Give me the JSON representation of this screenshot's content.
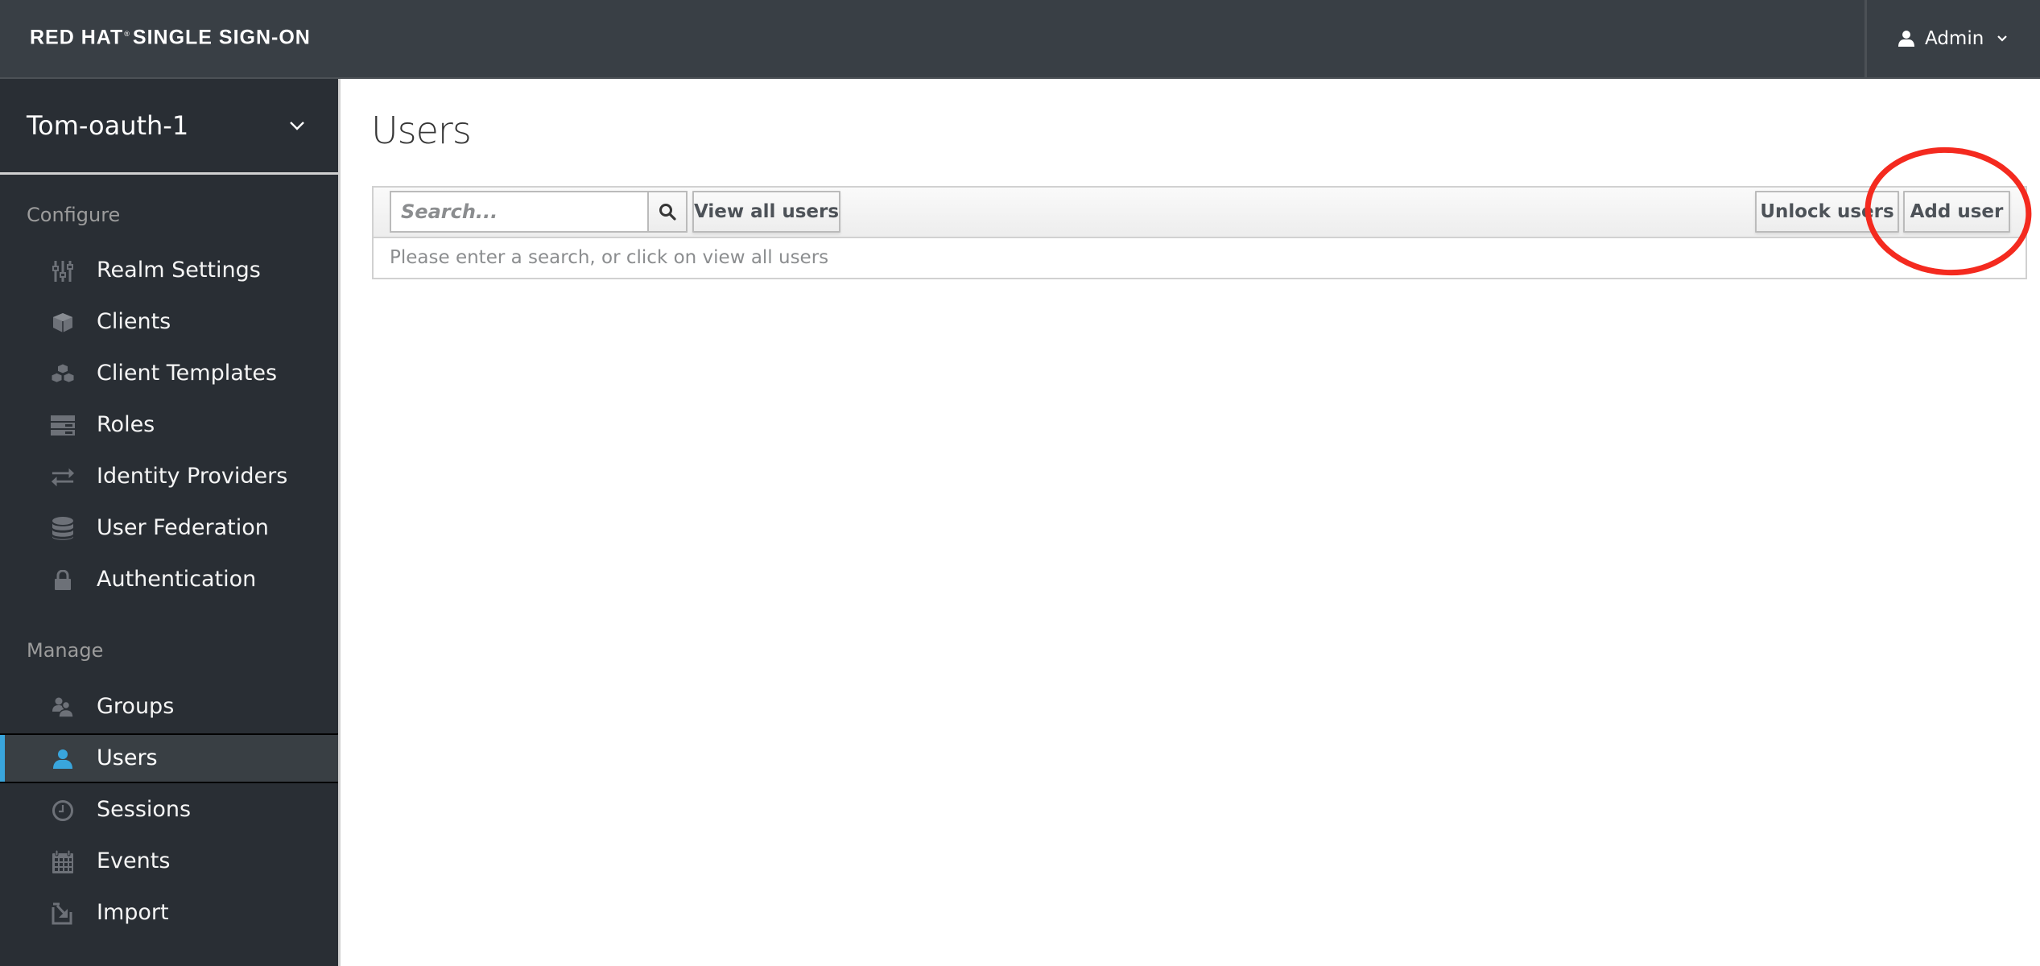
{
  "header": {
    "brand_bold": "RED HAT",
    "brand_reg": "®",
    "brand_rest": "SINGLE SIGN-ON",
    "user_icon": "user-icon",
    "user_name": "Admin",
    "user_caret_icon": "chevron-down-icon"
  },
  "sidebar": {
    "realm": {
      "name": "Tom-oauth-1",
      "caret_icon": "chevron-down-icon"
    },
    "sections": [
      {
        "title": "Configure",
        "items": [
          {
            "label": "Realm Settings",
            "icon": "sliders-icon",
            "active": false
          },
          {
            "label": "Clients",
            "icon": "cube-icon",
            "active": false
          },
          {
            "label": "Client Templates",
            "icon": "cubes-icon",
            "active": false
          },
          {
            "label": "Roles",
            "icon": "server-icon",
            "active": false
          },
          {
            "label": "Identity Providers",
            "icon": "exchange-icon",
            "active": false
          },
          {
            "label": "User Federation",
            "icon": "database-icon",
            "active": false
          },
          {
            "label": "Authentication",
            "icon": "lock-icon",
            "active": false
          }
        ]
      },
      {
        "title": "Manage",
        "items": [
          {
            "label": "Groups",
            "icon": "users-icon",
            "active": false
          },
          {
            "label": "Users",
            "icon": "user-icon",
            "active": true
          },
          {
            "label": "Sessions",
            "icon": "clock-icon",
            "active": false
          },
          {
            "label": "Events",
            "icon": "calendar-icon",
            "active": false
          },
          {
            "label": "Import",
            "icon": "import-icon",
            "active": false
          }
        ]
      }
    ]
  },
  "main": {
    "title": "Users",
    "toolbar": {
      "search_placeholder": "Search...",
      "search_value": "",
      "search_icon": "search-icon",
      "view_all_label": "View all users",
      "unlock_label": "Unlock users",
      "add_label": "Add user"
    },
    "empty_message": "Please enter a search, or click on view all users"
  },
  "annotation": {
    "shape": "ellipse",
    "target": "Add user",
    "color": "#f42a1f"
  },
  "colors": {
    "header_bg": "#393f45",
    "sidebar_bg": "#292e34",
    "active_accent": "#39a5dc",
    "active_bg": "#393f44"
  }
}
